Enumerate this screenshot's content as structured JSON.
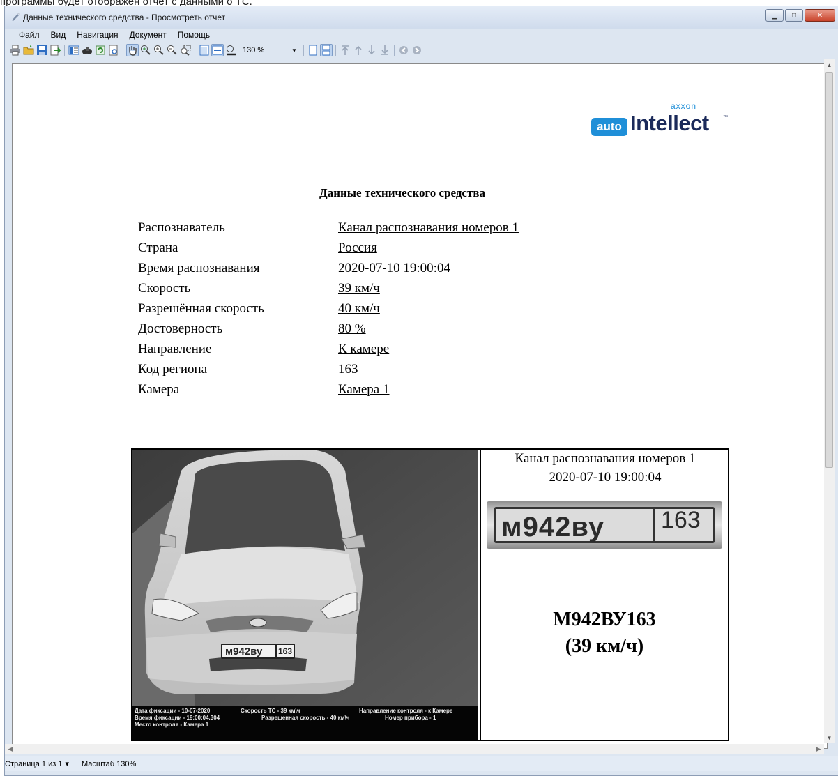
{
  "page_fragment": "программы будет отображен отчет с данными о ТС.",
  "window": {
    "title": "Данные технического средства - Просмотреть отчет",
    "controls": {
      "minimize": "▁",
      "maximize": "□",
      "close": "✕"
    }
  },
  "menu": [
    "Файл",
    "Вид",
    "Навигация",
    "Документ",
    "Помощь"
  ],
  "toolbar": {
    "zoom": "130 %"
  },
  "report": {
    "logo": {
      "axxon": "axxon",
      "auto": "auto",
      "intellect": "Intellect",
      "tm": "™"
    },
    "title": "Данные технического средства",
    "fields": [
      {
        "label": "Распознаватель",
        "value": "Канал распознавания номеров 1"
      },
      {
        "label": "Страна",
        "value": "Россия"
      },
      {
        "label": "Время распознавания",
        "value": "2020-07-10 19:00:04"
      },
      {
        "label": "Скорость",
        "value": "39 км/ч"
      },
      {
        "label": "Разрешённая скорость",
        "value": "40 км/ч"
      },
      {
        "label": "Достоверность",
        "value": "80 %"
      },
      {
        "label": "Направление",
        "value": "К камере"
      },
      {
        "label": "Код региона",
        "value": "163"
      },
      {
        "label": "Камера",
        "value": "Камера 1"
      }
    ],
    "photo": {
      "caption": [
        [
          "Дата фиксации - 10-07-2020",
          "Скорость ТС - 39 км\\ч",
          "Направление контроля - к Камере"
        ],
        [
          "Время фиксации - 19:00:04.304",
          "Разрешенная скорость - 40 км\\ч",
          "Номер прибора - 1"
        ],
        [
          "Место контроля - Камера 1"
        ]
      ],
      "car_plate": {
        "number": "м942ву",
        "region": "163"
      }
    },
    "side": {
      "channel": "Канал распознавания номеров 1",
      "time": "2020-07-10 19:00:04",
      "plate_crop": {
        "number": "м942ву",
        "region": "163"
      },
      "plate_text": "М942ВУ163",
      "speed_text": "(39 км/ч)"
    }
  },
  "statusbar": {
    "page": "Страница 1 из 1",
    "page_arrow": "▾",
    "scale": "Масштаб 130%"
  }
}
